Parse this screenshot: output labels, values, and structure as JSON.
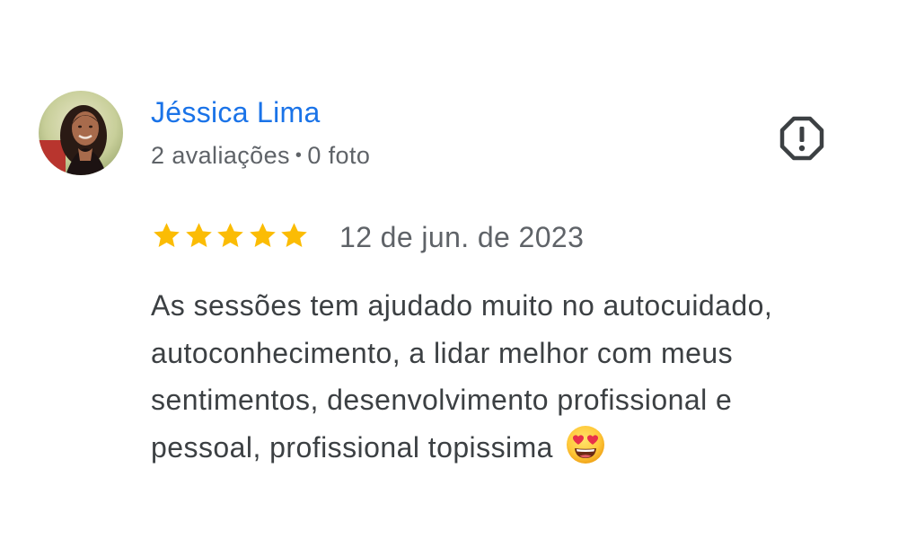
{
  "review": {
    "author": {
      "name": "Jéssica Lima",
      "reviews_count": "2 avaliações",
      "separator": "•",
      "photos_count": "0 foto",
      "avatar_icon": "profile-photo"
    },
    "report_icon": "report-flag-octagon-icon",
    "rating": 5,
    "rating_max": 5,
    "date": "12 de jun. de 2023",
    "text_lines": [
      "As sessões tem ajudado muito no autocuidado,",
      "autoconhecimento, a lidar melhor com meus",
      "sentimentos, desenvolvimento profissional e",
      "pessoal, profissional topissima"
    ],
    "emoji": "heart-eyes-emoji",
    "colors": {
      "name": "#1a73e8",
      "star": "#fbbc04",
      "meta": "#5f6368",
      "body": "#3c4043"
    }
  }
}
